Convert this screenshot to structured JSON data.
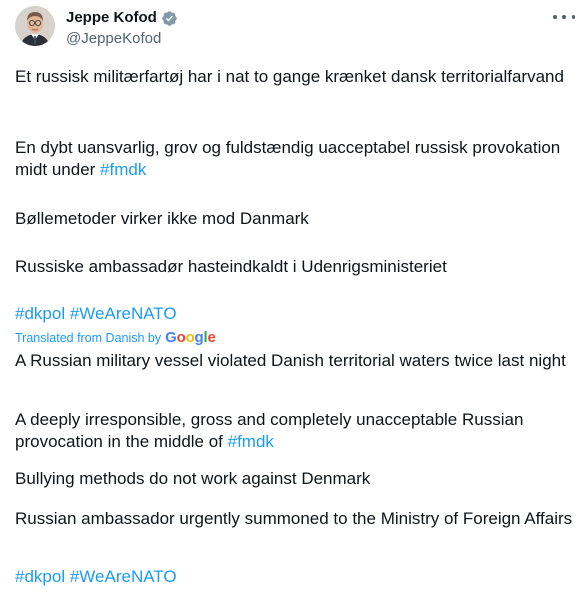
{
  "author": {
    "display_name": "Jeppe Kofod",
    "handle": "@JeppeKofod",
    "verified_icon": "verified-badge-icon",
    "avatar_icon": "avatar-photo",
    "more_icon": "more-options-icon"
  },
  "colors": {
    "link": "#1d9bf0",
    "text": "#0f1419",
    "muted": "#536471",
    "badge": "#829aab"
  },
  "original": {
    "p1": "Et russisk militærfartøj har i nat to gange krænket dansk territorialfarvand",
    "p2_text": "En dybt uansvarlig, grov og fuldstændig uacceptabel russisk provokation midt under ",
    "p2_hashtag": "#fmdk",
    "p3": "Bøllemetoder virker ikke mod Danmark",
    "p4": "Russiske ambassadør hasteindkaldt i Udenrigsministeriet",
    "hashtag_1": "#dkpol",
    "hashtag_2": "#WeAreNATO"
  },
  "translation": {
    "label": "Translated from Danish by",
    "provider": {
      "g1": "G",
      "g2": "o",
      "g3": "o",
      "g4": "g",
      "g5": "l",
      "g6": "e"
    },
    "p1": "A Russian military vessel violated Danish territorial waters twice last night",
    "p2_text": "A deeply irresponsible, gross and completely unacceptable Russian provocation in the middle of ",
    "p2_hashtag": "#fmdk",
    "p3": "Bullying methods do not work against Denmark",
    "p4": "Russian ambassador urgently summoned to the Ministry of Foreign Affairs",
    "hashtag_1": "#dkpol",
    "hashtag_2": "#WeAreNATO"
  }
}
